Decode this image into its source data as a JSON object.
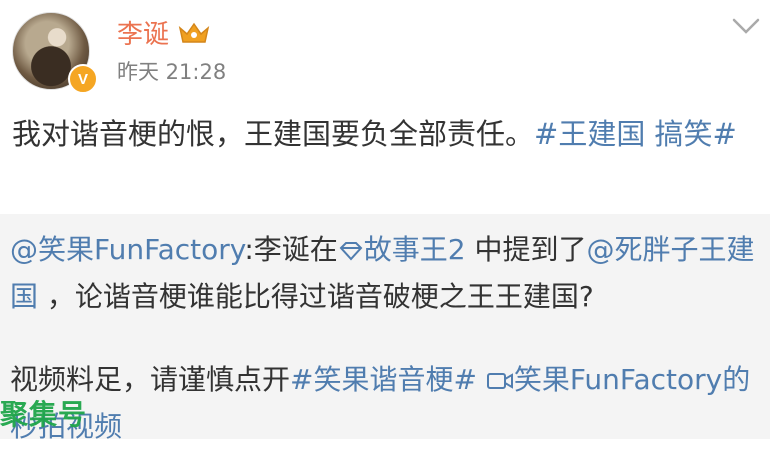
{
  "post": {
    "username": "李诞",
    "timestamp": "昨天 21:28",
    "verified_mark": "V",
    "text_main": "我对谐音梗的恨，王建国要负全部责任。",
    "hashtag": "#王建国 搞笑#"
  },
  "repost": {
    "author": "@笑果FunFactory",
    "text_a": ":李诞在",
    "topic": "故事王2",
    "text_b": " 中提到了",
    "mention": "@死胖子王建国",
    "text_c": " ，论谐音梗谁能比得过谐音破梗之王王建国?",
    "text_d": "视频料足，请谨慎点开",
    "hashtag": "#笑果谐音梗#",
    "video_link": "笑果FunFactory的秒拍视频"
  },
  "watermark": "聚集号",
  "colors": {
    "username": "#eb7350",
    "link": "#507daf",
    "repost_bg": "#f4f4f4",
    "badge": "#f5a623",
    "watermark": "#1fa64a"
  },
  "icons": [
    "crown-icon",
    "chevron-down-icon",
    "diamond-icon",
    "video-icon",
    "verified-badge-icon"
  ]
}
